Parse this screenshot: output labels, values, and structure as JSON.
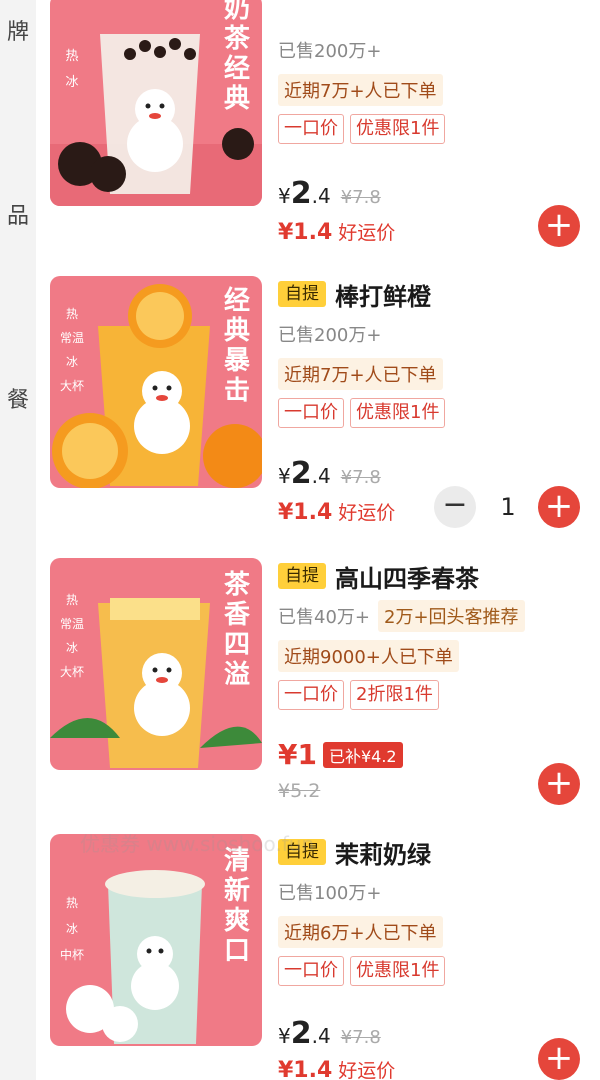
{
  "sidebar": {
    "items": [
      {
        "label": "牌"
      },
      {
        "label": "品"
      },
      {
        "label": "餐"
      }
    ]
  },
  "colors": {
    "accent_red": "#e5463b",
    "pickup_yellow": "#ffcf3a",
    "card_pink": "#f07a86"
  },
  "products": [
    {
      "name": "",
      "image_text": "奶茶经典",
      "sold": "已售200万+",
      "recent": "近期7万+人已下单",
      "tags": [
        "一口价",
        "优惠限1件"
      ],
      "price_yen": "¥",
      "price_int": "2",
      "price_dec": ".4",
      "orig_price": "¥7.8",
      "lucky_price": "¥1.4",
      "lucky_label": "好运价",
      "options": [
        "热",
        "冰"
      ]
    },
    {
      "pickup": "自提",
      "name": "棒打鲜橙",
      "image_text": "经典暴击",
      "sold": "已售200万+",
      "recent": "近期7万+人已下单",
      "tags": [
        "一口价",
        "优惠限1件"
      ],
      "price_yen": "¥",
      "price_int": "2",
      "price_dec": ".4",
      "orig_price": "¥7.8",
      "lucky_price": "¥1.4",
      "lucky_label": "好运价",
      "quantity": "1",
      "options": [
        "热",
        "常温",
        "冰",
        "大杯"
      ]
    },
    {
      "pickup": "自提",
      "name": "高山四季春茶",
      "image_text": "茶香四溢",
      "sold": "已售40万+",
      "recommend": "2万+回头客推荐",
      "recent": "近期9000+人已下单",
      "tags": [
        "一口价",
        "2折限1件"
      ],
      "price": "¥1",
      "subsidy": "已补¥4.2",
      "orig_price": "¥5.2",
      "options": [
        "热",
        "常温",
        "冰",
        "大杯"
      ]
    },
    {
      "pickup": "自提",
      "name": "茉莉奶绿",
      "image_text": "清新爽口",
      "sold": "已售100万+",
      "recent": "近期6万+人已下单",
      "tags": [
        "一口价",
        "优惠限1件"
      ],
      "price_yen": "¥",
      "price_int": "2",
      "price_dec": ".4",
      "orig_price": "¥7.8",
      "lucky_price": "¥1.4",
      "lucky_label": "好运价",
      "options": [
        "热",
        "冰",
        "中杯"
      ]
    }
  ],
  "watermark": "优惠券 www.sioshoo.fun",
  "icons": {
    "add": "plus-icon",
    "minus": "minus-icon"
  }
}
